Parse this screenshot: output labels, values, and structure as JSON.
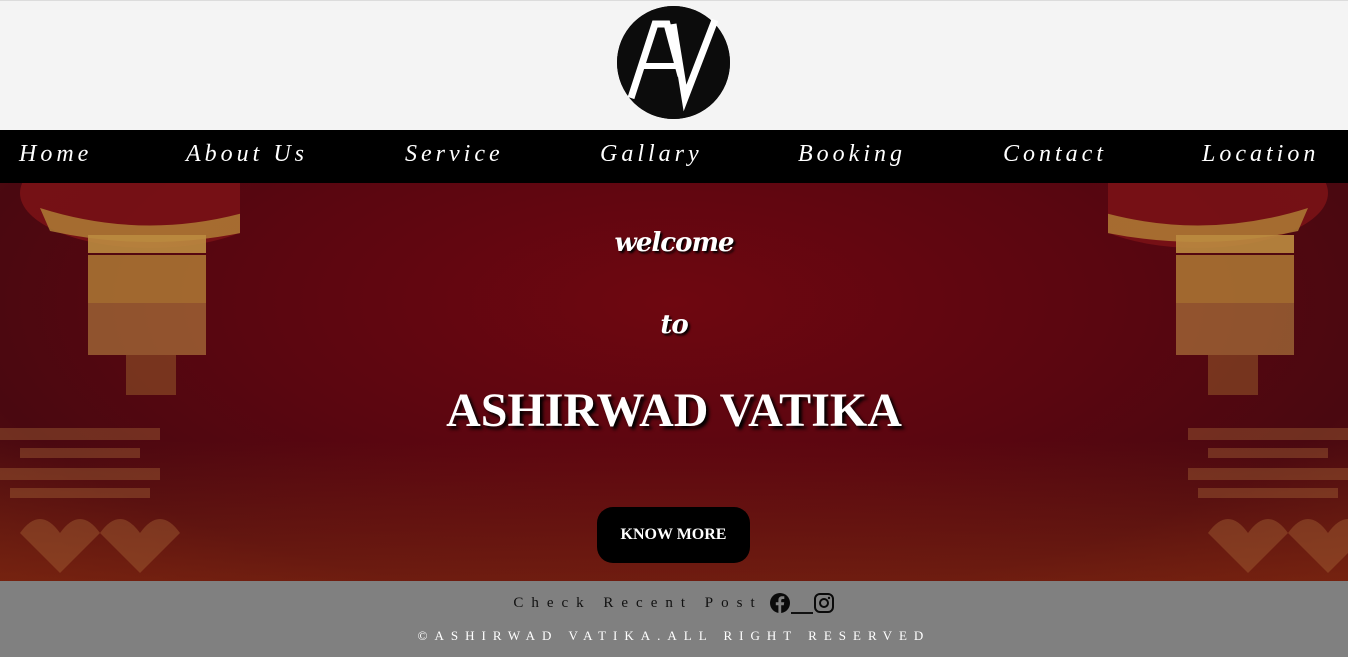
{
  "brand": {
    "logo_text": "AV",
    "logo_bg": "#0c0c0c",
    "logo_fg": "#ffffff"
  },
  "nav": {
    "items": [
      {
        "label": "Home"
      },
      {
        "label": "About Us"
      },
      {
        "label": "Service"
      },
      {
        "label": "Gallary"
      },
      {
        "label": "Booking"
      },
      {
        "label": "Contact"
      },
      {
        "label": "Location"
      }
    ]
  },
  "hero": {
    "welcome": "welcome",
    "to": "to",
    "title": "ASHIRWAD VATIKA",
    "cta_label": "KNOW MORE",
    "bg_color": "#5a0610"
  },
  "footer": {
    "recent_label": "Check Recent Post",
    "social": [
      "facebook-icon",
      "instagram-icon"
    ],
    "copyright": "©ASHIRWAD VATIKA.ALL RIGHT RESERVED",
    "bg_color": "#808080"
  }
}
